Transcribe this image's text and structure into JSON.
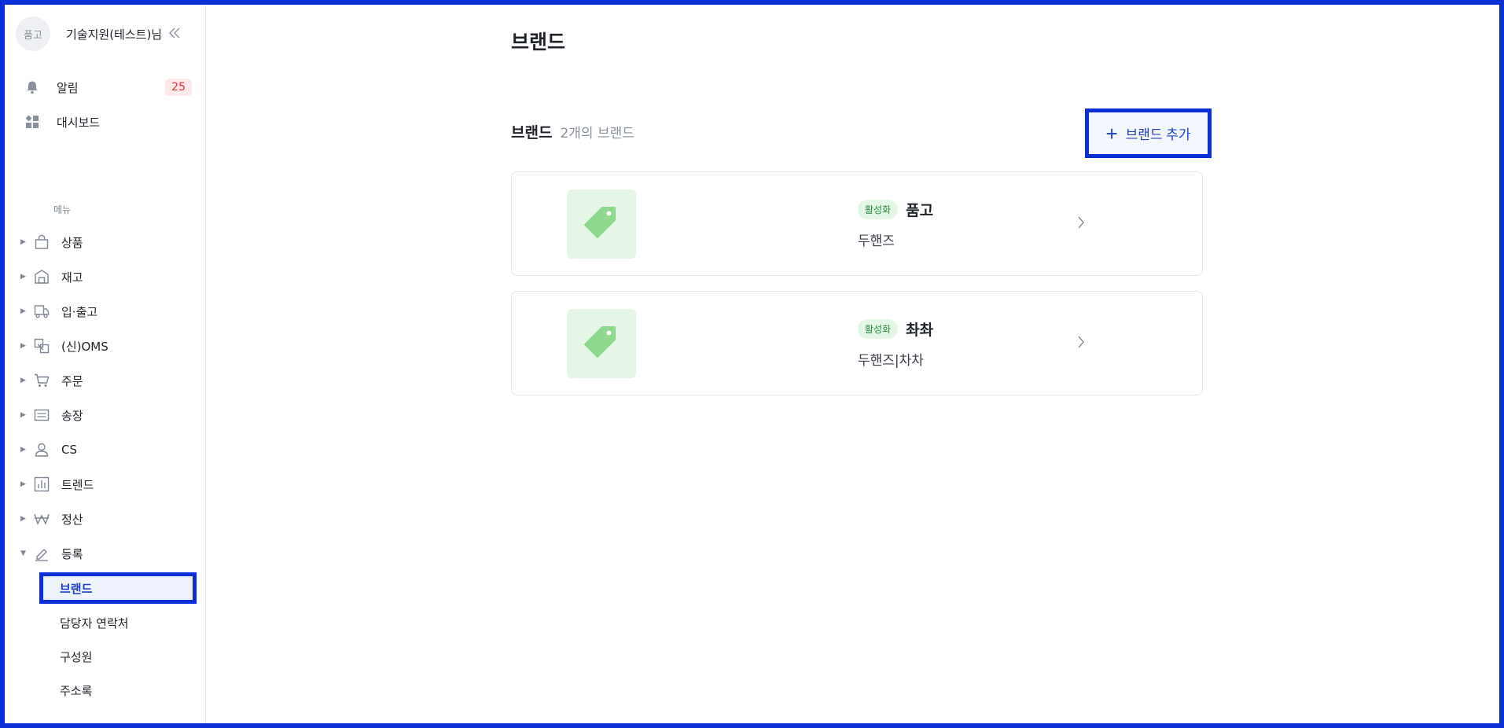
{
  "profile": {
    "avatar_text": "품고",
    "name": "기술지원(테스트)님",
    "collapse_icon": "double-chevron-left-icon"
  },
  "top_nav": {
    "notifications": {
      "label": "알림",
      "count": "25",
      "icon": "bell-icon"
    },
    "dashboard": {
      "label": "대시보드",
      "icon": "dashboard-icon"
    }
  },
  "menu": {
    "caption": "메뉴",
    "items": [
      {
        "label": "상품",
        "icon": "bag-icon",
        "expanded": false
      },
      {
        "label": "재고",
        "icon": "warehouse-icon",
        "expanded": false
      },
      {
        "label": "입·출고",
        "icon": "truck-icon",
        "expanded": false
      },
      {
        "label": "(신)OMS",
        "icon": "transfer-icon",
        "expanded": false
      },
      {
        "label": "주문",
        "icon": "cart-icon",
        "expanded": false
      },
      {
        "label": "송장",
        "icon": "invoice-icon",
        "expanded": false
      },
      {
        "label": "CS",
        "icon": "person-icon",
        "expanded": false
      },
      {
        "label": "트렌드",
        "icon": "bar-chart-icon",
        "expanded": false
      },
      {
        "label": "정산",
        "icon": "won-icon",
        "expanded": false
      },
      {
        "label": "등록",
        "icon": "pencil-icon",
        "expanded": true
      }
    ],
    "sub_items": [
      {
        "label": "브랜드",
        "active": true
      },
      {
        "label": "담당자 연락처",
        "active": false
      },
      {
        "label": "구성원",
        "active": false
      },
      {
        "label": "주소록",
        "active": false
      }
    ]
  },
  "main": {
    "page_title": "브랜드",
    "section_title": "브랜드",
    "section_count": "2개의 브랜드",
    "add_button_label": "브랜드 추가",
    "brands": [
      {
        "status": "활성화",
        "name": "품고",
        "subtitle": "두핸즈",
        "icon": "tag-icon"
      },
      {
        "status": "활성화",
        "name": "촤촤",
        "subtitle": "두핸즈|차차",
        "icon": "tag-icon"
      }
    ]
  },
  "colors": {
    "accent": "#1e40c8",
    "highlight_border": "#0a2fd6",
    "badge_bg": "#fde8ea",
    "badge_text": "#e0313e",
    "status_bg": "#e4f6e6",
    "status_text": "#2b8a3e",
    "tag_icon": "#8fd98f"
  }
}
